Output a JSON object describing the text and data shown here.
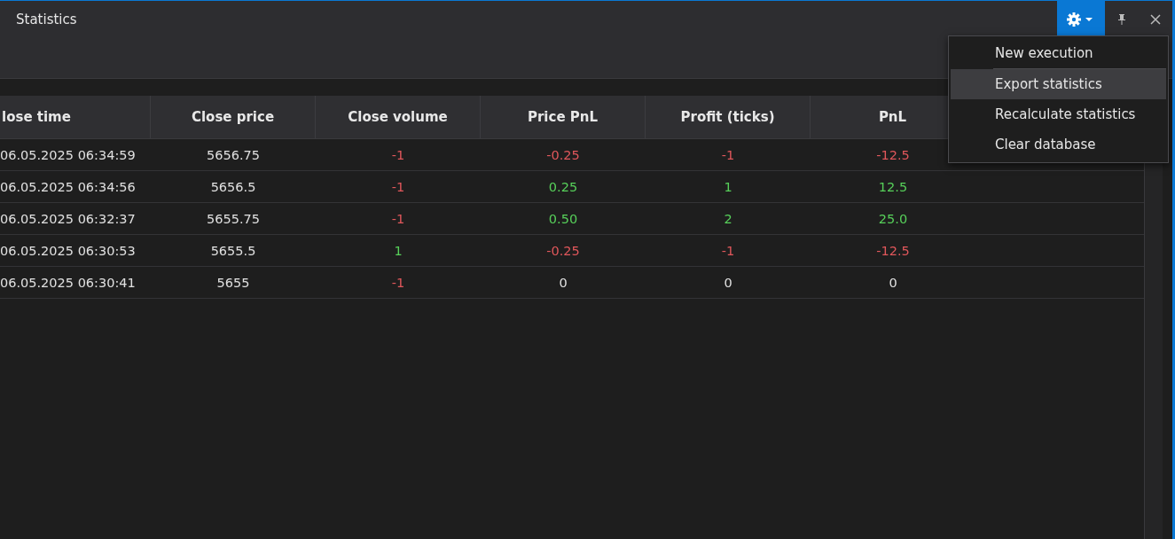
{
  "window": {
    "title": "Statistics"
  },
  "toolbar": {
    "settings_active": true
  },
  "table": {
    "columns": [
      "lose time",
      "Close price",
      "Close volume",
      "Price PnL",
      "Profit (ticks)",
      "PnL"
    ],
    "rows": [
      {
        "cells": [
          {
            "text": "06.05.2025 06:34:59",
            "color": "#e0e0e0"
          },
          {
            "text": "5656.75",
            "color": "#e0e0e0"
          },
          {
            "text": "-1",
            "color": "#e0575b"
          },
          {
            "text": "-0.25",
            "color": "#e0575b"
          },
          {
            "text": "-1",
            "color": "#e0575b"
          },
          {
            "text": "-12.5",
            "color": "#e0575b"
          }
        ]
      },
      {
        "cells": [
          {
            "text": "06.05.2025 06:34:56",
            "color": "#e0e0e0"
          },
          {
            "text": "5656.5",
            "color": "#e0e0e0"
          },
          {
            "text": "-1",
            "color": "#e0575b"
          },
          {
            "text": "0.25",
            "color": "#57d05a"
          },
          {
            "text": "1",
            "color": "#57d05a"
          },
          {
            "text": "12.5",
            "color": "#57d05a"
          }
        ]
      },
      {
        "cells": [
          {
            "text": "06.05.2025 06:32:37",
            "color": "#e0e0e0"
          },
          {
            "text": "5655.75",
            "color": "#e0e0e0"
          },
          {
            "text": "-1",
            "color": "#e0575b"
          },
          {
            "text": "0.50",
            "color": "#57d05a"
          },
          {
            "text": "2",
            "color": "#57d05a"
          },
          {
            "text": "25.0",
            "color": "#57d05a"
          }
        ]
      },
      {
        "cells": [
          {
            "text": "06.05.2025 06:30:53",
            "color": "#e0e0e0"
          },
          {
            "text": "5655.5",
            "color": "#e0e0e0"
          },
          {
            "text": "1",
            "color": "#57d05a"
          },
          {
            "text": "-0.25",
            "color": "#e0575b"
          },
          {
            "text": "-1",
            "color": "#e0575b"
          },
          {
            "text": "-12.5",
            "color": "#e0575b"
          }
        ]
      },
      {
        "cells": [
          {
            "text": "06.05.2025 06:30:41",
            "color": "#e0e0e0"
          },
          {
            "text": "5655",
            "color": "#e0e0e0"
          },
          {
            "text": "-1",
            "color": "#e0575b"
          },
          {
            "text": "0",
            "color": "#e0e0e0"
          },
          {
            "text": "0",
            "color": "#e0e0e0"
          },
          {
            "text": "0",
            "color": "#e0e0e0"
          }
        ]
      }
    ]
  },
  "menu": {
    "items": [
      {
        "label": "New execution",
        "selected": false,
        "divider_after": true
      },
      {
        "label": "Export statistics",
        "selected": true,
        "divider_after": false
      },
      {
        "label": "Recalculate statistics",
        "selected": false,
        "divider_after": false
      },
      {
        "label": "Clear database",
        "selected": false,
        "divider_after": false
      }
    ]
  }
}
